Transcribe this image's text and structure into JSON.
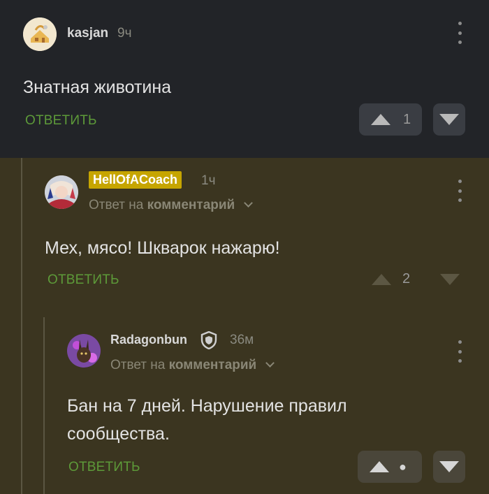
{
  "comments": [
    {
      "username": "kasjan",
      "time": "9ч",
      "text": "Знатная животина",
      "reply_label": "ОТВЕТИТЬ",
      "rating": "1"
    },
    {
      "username": "HellOfACoach",
      "time": "1ч",
      "reply_prefix": "Ответ на",
      "reply_target": "комментарий",
      "text": "Мех, мясо! Шкварок нажарю!",
      "reply_label": "ОТВЕТИТЬ",
      "rating": "2"
    },
    {
      "username": "Radagonbun",
      "time": "36м",
      "reply_prefix": "Ответ на",
      "reply_target": "комментарий",
      "text_line1": "Бан на 7 дней. Нарушение правил",
      "text_line2": "сообщества.",
      "reply_label": "ОТВЕТИТЬ",
      "rating": "●"
    }
  ],
  "colors": {
    "top_bg": "#222428",
    "thread_bg": "#3b3520",
    "reply_green": "#5d9a39",
    "badge_gold": "#c6a500"
  },
  "icons": [
    "more-vert-icon",
    "arrow-up-icon",
    "arrow-down-icon",
    "shield-icon",
    "chevron-down-icon"
  ]
}
